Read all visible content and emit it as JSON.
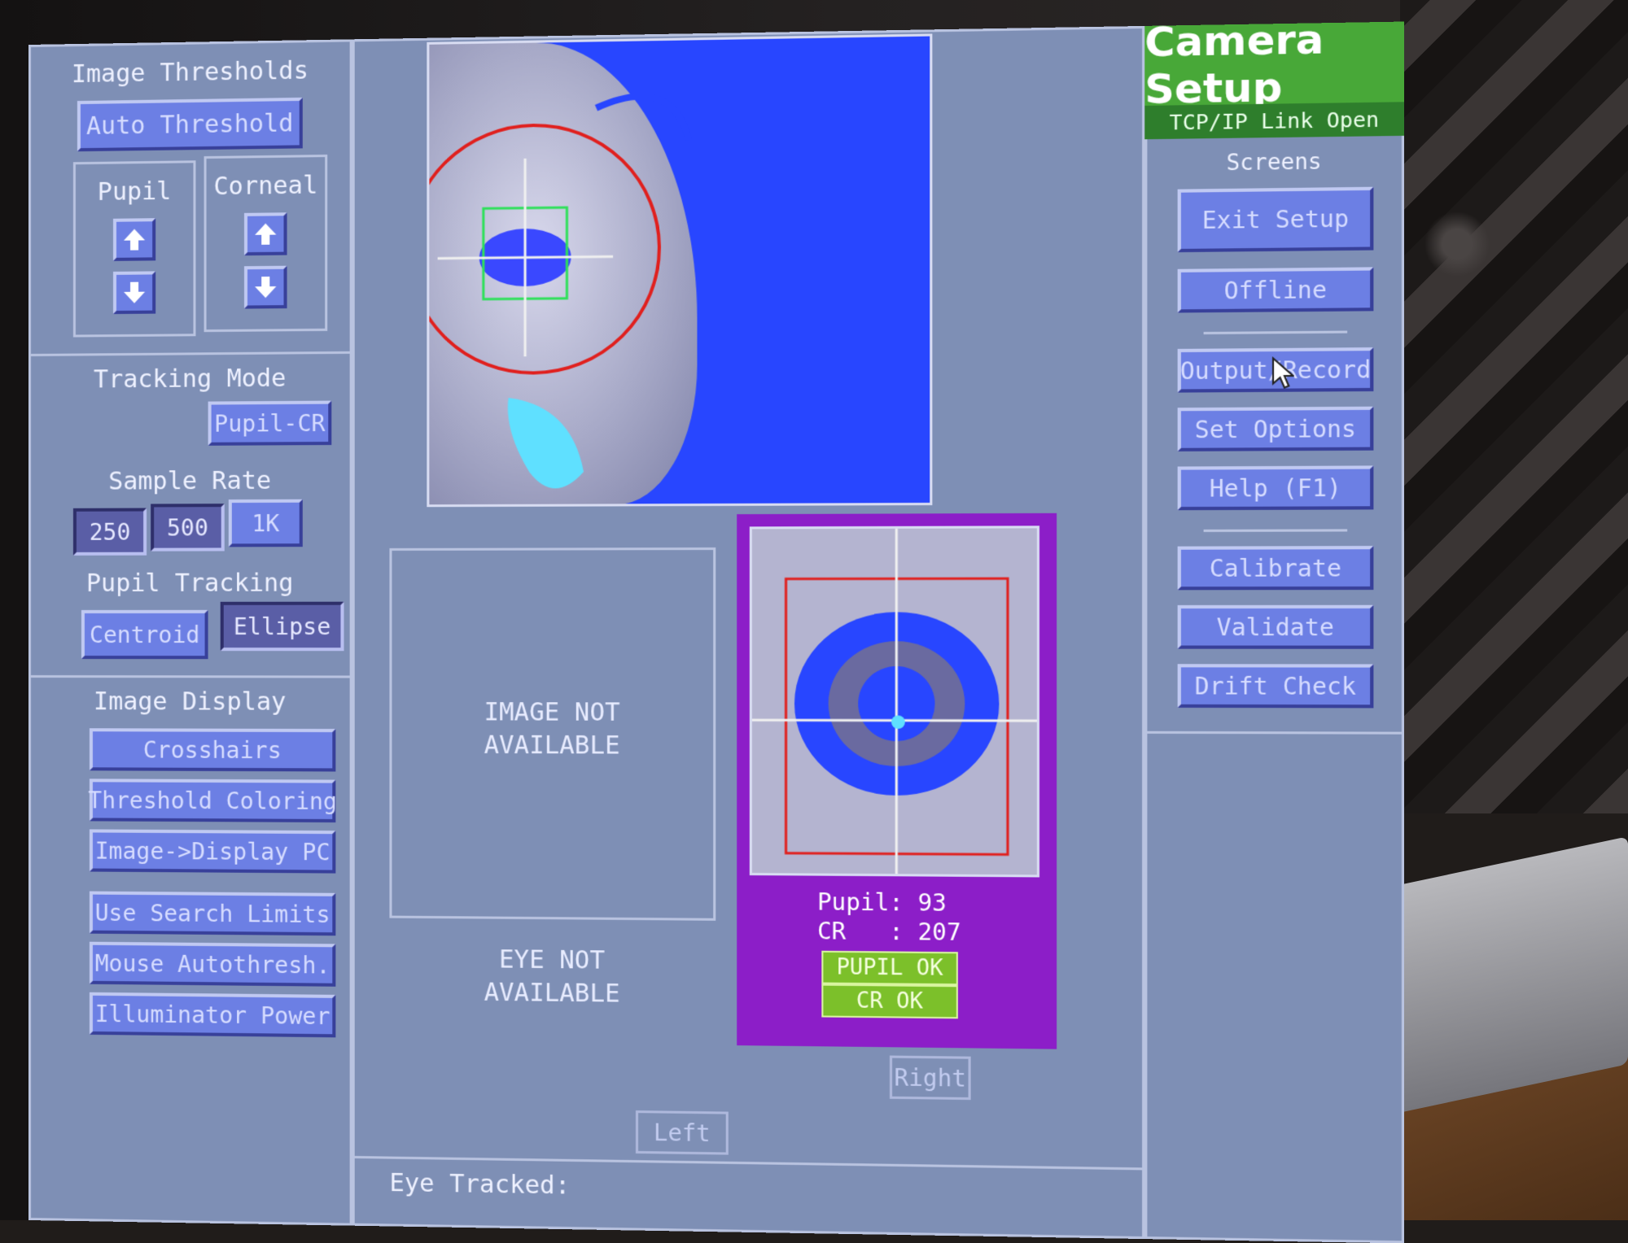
{
  "thresholds": {
    "title": "Image Thresholds",
    "auto_threshold": "Auto Threshold",
    "pupil_label": "Pupil",
    "corneal_label": "Corneal"
  },
  "tracking_mode": {
    "title": "Tracking Mode",
    "value": "Pupil-CR"
  },
  "sample_rate": {
    "title": "Sample Rate",
    "options": [
      "250",
      "500",
      "1K"
    ]
  },
  "pupil_tracking": {
    "title": "Pupil Tracking",
    "centroid": "Centroid",
    "ellipse": "Ellipse"
  },
  "image_display": {
    "title": "Image Display",
    "buttons": [
      "Crosshairs",
      "Threshold Coloring",
      "Image->Display PC",
      "Use Search Limits",
      "Mouse Autothresh.",
      "Illuminator Power"
    ]
  },
  "center": {
    "image_not_available": [
      "IMAGE NOT",
      "AVAILABLE"
    ],
    "eye_not_available": [
      "EYE NOT",
      "AVAILABLE"
    ],
    "pupil_readout": "Pupil: 93",
    "cr_readout": "CR   : 207",
    "pupil_ok": "PUPIL OK",
    "cr_ok": "CR  OK",
    "right": "Right",
    "left": "Left",
    "eye_tracked": "Eye Tracked:"
  },
  "sidebar": {
    "title": "Camera Setup",
    "link_status": "TCP/IP Link Open",
    "screens_label": "Screens",
    "buttons": [
      "Exit Setup",
      "Offline",
      "Output/Record",
      "Set Options",
      "Help (F1)",
      "Calibrate",
      "Validate",
      "Drift Check"
    ]
  },
  "colors": {
    "screen_bg": "#7e8fb5",
    "button": "#6c7fe4",
    "camera_green": "#48a838",
    "ok_green": "#7cc02a",
    "eye_panel_purple": "#8c1ec8",
    "threshold_blue": "#2846ff"
  }
}
